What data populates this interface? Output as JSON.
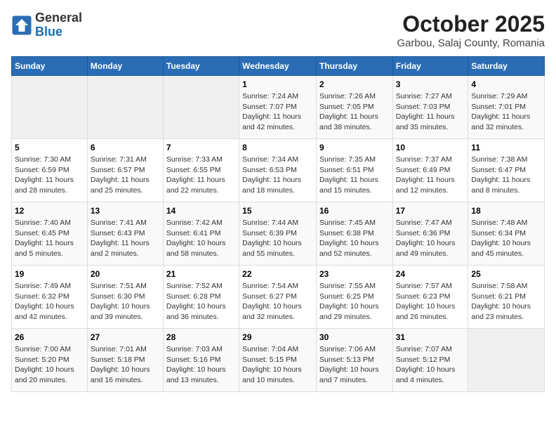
{
  "header": {
    "logo_general": "General",
    "logo_blue": "Blue",
    "month": "October 2025",
    "location": "Garbou, Salaj County, Romania"
  },
  "weekdays": [
    "Sunday",
    "Monday",
    "Tuesday",
    "Wednesday",
    "Thursday",
    "Friday",
    "Saturday"
  ],
  "weeks": [
    [
      {
        "day": "",
        "info": ""
      },
      {
        "day": "",
        "info": ""
      },
      {
        "day": "",
        "info": ""
      },
      {
        "day": "1",
        "info": "Sunrise: 7:24 AM\nSunset: 7:07 PM\nDaylight: 11 hours\nand 42 minutes."
      },
      {
        "day": "2",
        "info": "Sunrise: 7:26 AM\nSunset: 7:05 PM\nDaylight: 11 hours\nand 38 minutes."
      },
      {
        "day": "3",
        "info": "Sunrise: 7:27 AM\nSunset: 7:03 PM\nDaylight: 11 hours\nand 35 minutes."
      },
      {
        "day": "4",
        "info": "Sunrise: 7:29 AM\nSunset: 7:01 PM\nDaylight: 11 hours\nand 32 minutes."
      }
    ],
    [
      {
        "day": "5",
        "info": "Sunrise: 7:30 AM\nSunset: 6:59 PM\nDaylight: 11 hours\nand 28 minutes."
      },
      {
        "day": "6",
        "info": "Sunrise: 7:31 AM\nSunset: 6:57 PM\nDaylight: 11 hours\nand 25 minutes."
      },
      {
        "day": "7",
        "info": "Sunrise: 7:33 AM\nSunset: 6:55 PM\nDaylight: 11 hours\nand 22 minutes."
      },
      {
        "day": "8",
        "info": "Sunrise: 7:34 AM\nSunset: 6:53 PM\nDaylight: 11 hours\nand 18 minutes."
      },
      {
        "day": "9",
        "info": "Sunrise: 7:35 AM\nSunset: 6:51 PM\nDaylight: 11 hours\nand 15 minutes."
      },
      {
        "day": "10",
        "info": "Sunrise: 7:37 AM\nSunset: 6:49 PM\nDaylight: 11 hours\nand 12 minutes."
      },
      {
        "day": "11",
        "info": "Sunrise: 7:38 AM\nSunset: 6:47 PM\nDaylight: 11 hours\nand 8 minutes."
      }
    ],
    [
      {
        "day": "12",
        "info": "Sunrise: 7:40 AM\nSunset: 6:45 PM\nDaylight: 11 hours\nand 5 minutes."
      },
      {
        "day": "13",
        "info": "Sunrise: 7:41 AM\nSunset: 6:43 PM\nDaylight: 11 hours\nand 2 minutes."
      },
      {
        "day": "14",
        "info": "Sunrise: 7:42 AM\nSunset: 6:41 PM\nDaylight: 10 hours\nand 58 minutes."
      },
      {
        "day": "15",
        "info": "Sunrise: 7:44 AM\nSunset: 6:39 PM\nDaylight: 10 hours\nand 55 minutes."
      },
      {
        "day": "16",
        "info": "Sunrise: 7:45 AM\nSunset: 6:38 PM\nDaylight: 10 hours\nand 52 minutes."
      },
      {
        "day": "17",
        "info": "Sunrise: 7:47 AM\nSunset: 6:36 PM\nDaylight: 10 hours\nand 49 minutes."
      },
      {
        "day": "18",
        "info": "Sunrise: 7:48 AM\nSunset: 6:34 PM\nDaylight: 10 hours\nand 45 minutes."
      }
    ],
    [
      {
        "day": "19",
        "info": "Sunrise: 7:49 AM\nSunset: 6:32 PM\nDaylight: 10 hours\nand 42 minutes."
      },
      {
        "day": "20",
        "info": "Sunrise: 7:51 AM\nSunset: 6:30 PM\nDaylight: 10 hours\nand 39 minutes."
      },
      {
        "day": "21",
        "info": "Sunrise: 7:52 AM\nSunset: 6:28 PM\nDaylight: 10 hours\nand 36 minutes."
      },
      {
        "day": "22",
        "info": "Sunrise: 7:54 AM\nSunset: 6:27 PM\nDaylight: 10 hours\nand 32 minutes."
      },
      {
        "day": "23",
        "info": "Sunrise: 7:55 AM\nSunset: 6:25 PM\nDaylight: 10 hours\nand 29 minutes."
      },
      {
        "day": "24",
        "info": "Sunrise: 7:57 AM\nSunset: 6:23 PM\nDaylight: 10 hours\nand 26 minutes."
      },
      {
        "day": "25",
        "info": "Sunrise: 7:58 AM\nSunset: 6:21 PM\nDaylight: 10 hours\nand 23 minutes."
      }
    ],
    [
      {
        "day": "26",
        "info": "Sunrise: 7:00 AM\nSunset: 5:20 PM\nDaylight: 10 hours\nand 20 minutes."
      },
      {
        "day": "27",
        "info": "Sunrise: 7:01 AM\nSunset: 5:18 PM\nDaylight: 10 hours\nand 16 minutes."
      },
      {
        "day": "28",
        "info": "Sunrise: 7:03 AM\nSunset: 5:16 PM\nDaylight: 10 hours\nand 13 minutes."
      },
      {
        "day": "29",
        "info": "Sunrise: 7:04 AM\nSunset: 5:15 PM\nDaylight: 10 hours\nand 10 minutes."
      },
      {
        "day": "30",
        "info": "Sunrise: 7:06 AM\nSunset: 5:13 PM\nDaylight: 10 hours\nand 7 minutes."
      },
      {
        "day": "31",
        "info": "Sunrise: 7:07 AM\nSunset: 5:12 PM\nDaylight: 10 hours\nand 4 minutes."
      },
      {
        "day": "",
        "info": ""
      }
    ]
  ]
}
